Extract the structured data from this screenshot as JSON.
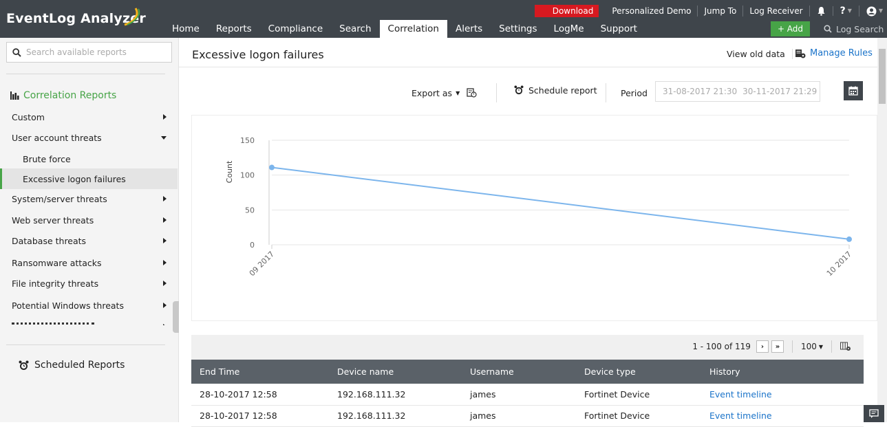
{
  "app": {
    "logo_text": "EventLog Analyzer"
  },
  "utilbar": {
    "download": "Download",
    "links": [
      "Personalized Demo",
      "Jump To",
      "Log Receiver"
    ],
    "help": "?"
  },
  "nav": {
    "tabs": [
      "Home",
      "Reports",
      "Compliance",
      "Search",
      "Correlation",
      "Alerts",
      "Settings",
      "LogMe",
      "Support"
    ],
    "active": "Correlation",
    "add_label": "+ Add",
    "log_search": "Log Search"
  },
  "sidebar": {
    "search_placeholder": "Search available reports",
    "section_title": "Correlation Reports",
    "items": [
      {
        "label": "Custom",
        "type": "collapsed"
      },
      {
        "label": "User account threats",
        "type": "expanded"
      },
      {
        "label": "Brute force",
        "type": "sub"
      },
      {
        "label": "Excessive logon failures",
        "type": "sub-active"
      },
      {
        "label": "System/server threats",
        "type": "collapsed"
      },
      {
        "label": "Web server threats",
        "type": "collapsed"
      },
      {
        "label": "Database threats",
        "type": "collapsed"
      },
      {
        "label": "Ransomware attacks",
        "type": "collapsed"
      },
      {
        "label": "File integrity threats",
        "type": "collapsed"
      },
      {
        "label": "Potential Windows threats",
        "type": "collapsed"
      }
    ],
    "scheduled_reports": "Scheduled Reports"
  },
  "main": {
    "title": "Excessive logon failures",
    "view_old_data": "View old data",
    "manage_rules": "Manage Rules",
    "export_as": "Export as",
    "schedule_report": "Schedule report",
    "period_label": "Period",
    "period_from": "31-08-2017 21:30",
    "period_to": "30-11-2017 21:29"
  },
  "chart_data": {
    "type": "line",
    "categories": [
      "09 2017",
      "10 2017"
    ],
    "series": [
      {
        "values": [
          111,
          8
        ]
      }
    ],
    "ylabel": "Count",
    "ylim": [
      0,
      150
    ],
    "yticks": [
      0,
      50,
      100,
      150
    ],
    "grid": true,
    "color": "#7cb5ec"
  },
  "table": {
    "pager_text": "1 - 100 of 119",
    "page_size": "100",
    "columns": [
      "End Time",
      "Device name",
      "Username",
      "Device type",
      "History"
    ],
    "rows": [
      [
        "28-10-2017 12:58",
        "192.168.111.32",
        "james",
        "Fortinet Device",
        "Event timeline"
      ],
      [
        "28-10-2017 12:58",
        "192.168.111.32",
        "james",
        "Fortinet Device",
        "Event timeline"
      ]
    ]
  },
  "colors": {
    "accent": "#47a447",
    "topbar": "#3f454b",
    "link": "#1a73c9",
    "download": "#d71920"
  }
}
